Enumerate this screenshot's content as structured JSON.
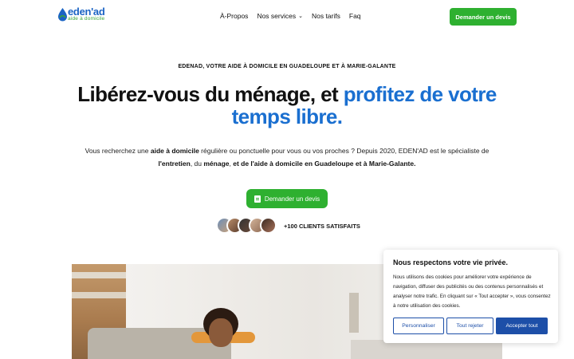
{
  "header": {
    "logo_text": "eden'ad",
    "logo_sub": "aide à domicile",
    "nav": [
      "À-Propos",
      "Nos services",
      "Nos tarifs",
      "Faq"
    ],
    "cta": "Demander un devis"
  },
  "hero": {
    "eyebrow": "EDENAD, VOTRE AIDE À DOMICILE EN GUADELOUPE ET À MARIE-GALANTE",
    "headline_black": "Libérez-vous du ménage, et ",
    "headline_blue": "profitez de votre temps libre.",
    "desc_parts": [
      "Vous recherchez une ",
      "aide à domicile",
      " régulière ou ponctuelle pour vous ou vos proches ? Depuis 2020, EDEN'AD est le spécialiste de ",
      "l'entretien",
      ", du ",
      "ménage",
      ", ",
      "et de l'aide à domicile en Guadeloupe et à Marie-Galante."
    ],
    "cta": "Demander un devis",
    "clients": "+100 CLIENTS SATISFAITS"
  },
  "cookie": {
    "title": "Nous respectons votre vie privée.",
    "text": "Nous utilisons des cookies pour améliorer votre expérience de navigation, diffuser des publicités ou des contenus personnalisés et analyser notre trafic. En cliquant sur « Tout accepter », vous consentez à notre utilisation des cookies.",
    "btn_customize": "Personnaliser",
    "btn_reject": "Tout rejeter",
    "btn_accept": "Accepter tout"
  },
  "colors": {
    "green": "#2eb030",
    "blue_headline": "#1a6fd0",
    "cookie_blue": "#1d4fa8"
  },
  "icons": [
    "logo-drop-icon",
    "chevron-down-icon",
    "document-icon"
  ]
}
